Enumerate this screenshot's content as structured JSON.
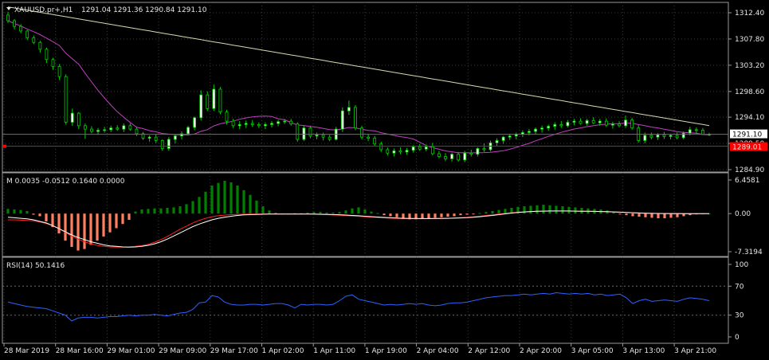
{
  "header": {
    "symbol_line": "XAUUSD.pr+,H1",
    "ohlc_line": "1291.04 1291.36 1290.84 1291.10"
  },
  "price_axis": {
    "ticks": [
      "1312.40",
      "1307.80",
      "1303.20",
      "1298.60",
      "1294.10",
      "1289.50",
      "1284.90"
    ],
    "current_price": "1291.10",
    "alert_price": "1289.01"
  },
  "momentum": {
    "label": "M 0.0035 -0.0512 0.1640 0.0000",
    "ticks": [
      "6.4581",
      "0.00",
      "-7.3194"
    ]
  },
  "rsi": {
    "label": "RSI(14) 50.1416",
    "ticks": [
      "100",
      "70",
      "30",
      "0"
    ]
  },
  "time_axis": {
    "labels": [
      "28 Mar 2019",
      "28 Mar 16:00",
      "29 Mar 01:00",
      "29 Mar 09:00",
      "29 Mar 17:00",
      "1 Apr 02:00",
      "1 Apr 11:00",
      "1 Apr 19:00",
      "2 Apr 04:00",
      "2 Apr 12:00",
      "2 Apr 20:00",
      "3 Apr 05:00",
      "3 Apr 13:00",
      "3 Apr 21:00"
    ]
  },
  "colors": {
    "background": "#000000",
    "grid": "#3a3a3a",
    "bull_candle": "#ffffff",
    "bear_candle": "#000000",
    "candle_outline": "#00d000",
    "ma_fast": "#c040c0",
    "ma_slow": "#d8d8b0",
    "alert_line": "#ff0000",
    "hist_positive": "#008000",
    "hist_negative": "#ff8060",
    "signal_line": "#ff2020",
    "main_line": "#ffffff",
    "rsi_line": "#3060ff"
  },
  "chart_data": [
    {
      "type": "candlestick",
      "title": "XAUUSD.pr+,H1",
      "ylim": [
        1284.9,
        1312.4
      ],
      "ohlc": [
        [
          1312.0,
          1312.6,
          1310.6,
          1311.0
        ],
        [
          1311.0,
          1311.3,
          1309.5,
          1310.0
        ],
        [
          1310.0,
          1310.4,
          1308.8,
          1309.2
        ],
        [
          1309.2,
          1309.4,
          1307.6,
          1308.0
        ],
        [
          1308.0,
          1308.4,
          1306.9,
          1307.2
        ],
        [
          1307.2,
          1307.5,
          1305.4,
          1306.0
        ],
        [
          1306.0,
          1306.3,
          1303.6,
          1304.2
        ],
        [
          1304.2,
          1304.5,
          1302.4,
          1303.0
        ],
        [
          1303.0,
          1303.4,
          1300.6,
          1301.2
        ],
        [
          1301.2,
          1301.6,
          1292.8,
          1293.2
        ],
        [
          1293.2,
          1295.6,
          1292.6,
          1294.8
        ],
        [
          1294.8,
          1295.0,
          1292.0,
          1292.6
        ],
        [
          1292.6,
          1293.0,
          1290.3,
          1292.0
        ],
        [
          1292.0,
          1292.5,
          1291.3,
          1291.6
        ],
        [
          1291.6,
          1292.2,
          1291.0,
          1291.8
        ],
        [
          1291.8,
          1292.4,
          1291.4,
          1291.9
        ],
        [
          1291.9,
          1292.6,
          1291.5,
          1292.2
        ],
        [
          1292.2,
          1292.7,
          1291.7,
          1292.0
        ],
        [
          1292.0,
          1293.0,
          1291.5,
          1292.6
        ],
        [
          1292.6,
          1293.0,
          1291.7,
          1292.0
        ],
        [
          1292.0,
          1292.4,
          1290.8,
          1291.2
        ],
        [
          1291.2,
          1291.5,
          1290.1,
          1290.4
        ],
        [
          1290.4,
          1290.9,
          1289.8,
          1290.6
        ],
        [
          1290.6,
          1291.2,
          1289.6,
          1290.0
        ],
        [
          1290.0,
          1290.2,
          1288.2,
          1288.6
        ],
        [
          1288.6,
          1290.6,
          1288.2,
          1290.2
        ],
        [
          1290.2,
          1291.0,
          1289.5,
          1290.8
        ],
        [
          1290.8,
          1291.6,
          1290.2,
          1291.2
        ],
        [
          1291.2,
          1292.6,
          1290.9,
          1292.3
        ],
        [
          1292.3,
          1294.2,
          1291.8,
          1294.0
        ],
        [
          1294.0,
          1298.8,
          1293.5,
          1298.0
        ],
        [
          1298.0,
          1298.6,
          1295.2,
          1295.6
        ],
        [
          1295.6,
          1299.8,
          1295.2,
          1299.0
        ],
        [
          1299.0,
          1299.4,
          1294.6,
          1295.0
        ],
        [
          1295.0,
          1295.4,
          1292.8,
          1293.4
        ],
        [
          1293.4,
          1293.8,
          1292.2,
          1292.6
        ],
        [
          1292.6,
          1293.4,
          1292.0,
          1292.8
        ],
        [
          1292.8,
          1293.5,
          1292.2,
          1293.0
        ],
        [
          1293.0,
          1293.6,
          1292.4,
          1292.8
        ],
        [
          1292.8,
          1293.2,
          1292.2,
          1292.6
        ],
        [
          1292.6,
          1293.2,
          1292.0,
          1292.8
        ],
        [
          1292.8,
          1293.4,
          1292.3,
          1293.0
        ],
        [
          1293.0,
          1293.6,
          1292.5,
          1293.3
        ],
        [
          1293.3,
          1293.8,
          1292.9,
          1293.4
        ],
        [
          1293.4,
          1293.8,
          1292.6,
          1292.9
        ],
        [
          1292.9,
          1293.2,
          1289.8,
          1290.2
        ],
        [
          1290.2,
          1292.6,
          1289.9,
          1292.2
        ],
        [
          1292.2,
          1292.6,
          1290.4,
          1290.8
        ],
        [
          1290.8,
          1291.4,
          1290.2,
          1291.0
        ],
        [
          1291.0,
          1291.4,
          1290.0,
          1290.6
        ],
        [
          1290.6,
          1291.0,
          1289.9,
          1290.2
        ],
        [
          1290.2,
          1292.4,
          1290.0,
          1292.0
        ],
        [
          1292.0,
          1295.8,
          1291.5,
          1295.2
        ],
        [
          1295.2,
          1297.0,
          1294.5,
          1295.8
        ],
        [
          1295.8,
          1296.2,
          1291.8,
          1292.2
        ],
        [
          1292.2,
          1292.6,
          1290.2,
          1290.6
        ],
        [
          1290.6,
          1291.2,
          1289.9,
          1290.4
        ],
        [
          1290.4,
          1290.8,
          1289.0,
          1289.4
        ],
        [
          1289.4,
          1289.8,
          1288.0,
          1288.4
        ],
        [
          1288.4,
          1288.8,
          1287.4,
          1287.8
        ],
        [
          1287.8,
          1288.6,
          1287.2,
          1288.2
        ],
        [
          1288.2,
          1288.8,
          1287.6,
          1288.0
        ],
        [
          1288.0,
          1288.7,
          1287.5,
          1288.3
        ],
        [
          1288.3,
          1289.2,
          1287.9,
          1288.9
        ],
        [
          1288.9,
          1289.4,
          1288.2,
          1288.5
        ],
        [
          1288.5,
          1289.3,
          1288.1,
          1288.9
        ],
        [
          1288.9,
          1289.6,
          1287.4,
          1287.7
        ],
        [
          1287.7,
          1288.2,
          1286.9,
          1287.2
        ],
        [
          1287.2,
          1287.8,
          1286.4,
          1286.8
        ],
        [
          1286.8,
          1287.9,
          1286.3,
          1287.6
        ],
        [
          1287.6,
          1288.0,
          1286.3,
          1286.6
        ],
        [
          1286.6,
          1288.2,
          1286.2,
          1287.8
        ],
        [
          1287.8,
          1288.4,
          1287.2,
          1287.6
        ],
        [
          1287.6,
          1288.8,
          1287.2,
          1288.6
        ],
        [
          1288.6,
          1289.5,
          1288.0,
          1288.4
        ],
        [
          1288.4,
          1290.0,
          1288.1,
          1289.6
        ],
        [
          1289.6,
          1290.4,
          1289.0,
          1290.0
        ],
        [
          1290.0,
          1290.8,
          1289.4,
          1290.6
        ],
        [
          1290.6,
          1291.2,
          1290.1,
          1290.8
        ],
        [
          1290.8,
          1291.4,
          1290.2,
          1291.1
        ],
        [
          1291.1,
          1291.8,
          1290.6,
          1291.4
        ],
        [
          1291.4,
          1292.0,
          1290.9,
          1291.6
        ],
        [
          1291.6,
          1292.3,
          1291.1,
          1292.0
        ],
        [
          1292.0,
          1292.6,
          1291.4,
          1292.2
        ],
        [
          1292.2,
          1292.8,
          1291.7,
          1292.5
        ],
        [
          1292.5,
          1293.2,
          1291.9,
          1292.8
        ],
        [
          1292.8,
          1293.4,
          1292.2,
          1292.6
        ],
        [
          1292.6,
          1293.6,
          1292.3,
          1293.2
        ],
        [
          1293.2,
          1293.8,
          1292.7,
          1293.4
        ],
        [
          1293.4,
          1293.9,
          1292.8,
          1293.0
        ],
        [
          1293.0,
          1293.8,
          1292.6,
          1293.5
        ],
        [
          1293.5,
          1294.1,
          1292.9,
          1293.1
        ],
        [
          1293.1,
          1293.8,
          1292.6,
          1293.4
        ],
        [
          1293.4,
          1293.9,
          1292.4,
          1292.7
        ],
        [
          1292.7,
          1293.3,
          1292.1,
          1292.9
        ],
        [
          1292.9,
          1293.4,
          1292.3,
          1292.6
        ],
        [
          1292.6,
          1294.4,
          1292.2,
          1293.6
        ],
        [
          1293.6,
          1294.0,
          1291.9,
          1292.2
        ],
        [
          1292.2,
          1292.7,
          1289.6,
          1290.0
        ],
        [
          1290.0,
          1291.4,
          1289.5,
          1290.9
        ],
        [
          1290.9,
          1291.4,
          1290.2,
          1290.6
        ],
        [
          1290.6,
          1291.3,
          1290.1,
          1291.0
        ],
        [
          1291.0,
          1291.5,
          1290.3,
          1290.7
        ],
        [
          1290.7,
          1291.2,
          1290.2,
          1290.9
        ],
        [
          1290.9,
          1291.4,
          1290.2,
          1290.5
        ],
        [
          1290.5,
          1291.6,
          1290.2,
          1291.3
        ],
        [
          1291.3,
          1292.4,
          1290.9,
          1291.9
        ],
        [
          1291.9,
          1292.3,
          1291.2,
          1291.8
        ],
        [
          1291.8,
          1292.2,
          1291.0,
          1291.04
        ],
        [
          1291.04,
          1291.36,
          1290.84,
          1291.1
        ]
      ]
    },
    {
      "type": "bar+line",
      "title": "M 0.0035 -0.0512 0.1640 0.0000",
      "ylim": [
        -7.3194,
        6.4581
      ],
      "histogram": [
        0.9,
        0.8,
        0.7,
        0.5,
        -0.2,
        -0.5,
        -1.5,
        -2.6,
        -3.8,
        -5.2,
        -6.4,
        -7.1,
        -6.8,
        -6.0,
        -5.2,
        -4.4,
        -3.6,
        -2.8,
        -2.0,
        -1.2,
        0.4,
        0.8,
        0.9,
        1.0,
        1.0,
        1.1,
        1.2,
        1.4,
        1.8,
        2.4,
        3.2,
        4.2,
        5.4,
        5.9,
        6.3,
        6.0,
        5.4,
        4.5,
        3.6,
        2.5,
        1.4,
        0.6,
        0.2,
        0.0,
        0.0,
        0.1,
        0.1,
        0.2,
        0.3,
        0.3,
        0.2,
        0.2,
        0.3,
        0.6,
        1.0,
        1.2,
        0.8,
        0.4,
        0.1,
        -0.3,
        -0.5,
        -0.7,
        -1.0,
        -1.1,
        -1.1,
        -1.0,
        -0.9,
        -0.8,
        -0.7,
        -0.6,
        -0.5,
        -0.3,
        -0.2,
        -0.1,
        0.1,
        0.3,
        0.5,
        0.7,
        0.9,
        1.1,
        1.3,
        1.4,
        1.5,
        1.6,
        1.7,
        1.6,
        1.5,
        1.4,
        1.3,
        1.2,
        1.1,
        1.0,
        0.9,
        0.8,
        0.6,
        0.3,
        -0.1,
        -0.3,
        -0.5,
        -0.6,
        -0.7,
        -0.8,
        -0.9,
        -0.9,
        -0.8,
        -0.7,
        -0.5,
        -0.3,
        -0.1,
        0.0,
        0.0
      ],
      "main_line": [
        -0.7,
        -0.8,
        -0.9,
        -1.0,
        -1.2,
        -1.5,
        -1.8,
        -2.3,
        -2.9,
        -3.5,
        -4.1,
        -4.6,
        -5.0,
        -5.4,
        -5.7,
        -6.0,
        -6.2,
        -6.3,
        -6.4,
        -6.45,
        -6.4,
        -6.3,
        -6.1,
        -5.8,
        -5.4,
        -4.9,
        -4.3,
        -3.7,
        -3.1,
        -2.5,
        -2.0,
        -1.6,
        -1.2,
        -0.9,
        -0.7,
        -0.5,
        -0.35,
        -0.25,
        -0.2,
        -0.15,
        -0.12,
        -0.1,
        -0.1,
        -0.1,
        -0.1,
        -0.1,
        -0.1,
        -0.1,
        -0.1,
        -0.12,
        -0.14,
        -0.18,
        -0.22,
        -0.28,
        -0.35,
        -0.42,
        -0.5,
        -0.58,
        -0.66,
        -0.74,
        -0.8,
        -0.86,
        -0.9,
        -0.92,
        -0.94,
        -0.95,
        -0.95,
        -0.94,
        -0.92,
        -0.9,
        -0.87,
        -0.83,
        -0.78,
        -0.7,
        -0.6,
        -0.48,
        -0.35,
        -0.2,
        -0.05,
        0.1,
        0.22,
        0.32,
        0.4,
        0.45,
        0.48,
        0.5,
        0.5,
        0.5,
        0.5,
        0.48,
        0.46,
        0.44,
        0.42,
        0.4,
        0.36,
        0.32,
        0.27,
        0.22,
        0.17,
        0.12,
        0.08,
        0.05,
        0.03,
        0.02,
        0.01,
        0.01,
        0.0,
        0.0,
        0.0,
        0.0,
        0.0
      ],
      "signal_line": [
        -1.2,
        -1.2,
        -1.25,
        -1.3,
        -1.4,
        -1.6,
        -1.9,
        -2.3,
        -2.9,
        -3.6,
        -4.3,
        -4.9,
        -5.4,
        -5.8,
        -6.1,
        -6.3,
        -6.4,
        -6.45,
        -6.45,
        -6.4,
        -6.3,
        -6.15,
        -5.9,
        -5.5,
        -5.0,
        -4.4,
        -3.7,
        -3.0,
        -2.4,
        -1.8,
        -1.3,
        -0.9,
        -0.6,
        -0.4,
        -0.3,
        -0.2,
        -0.15,
        -0.12,
        -0.1,
        -0.1,
        -0.1,
        -0.1,
        -0.1,
        -0.1,
        -0.1,
        -0.1,
        -0.1,
        -0.1,
        -0.12,
        -0.15,
        -0.2,
        -0.26,
        -0.32,
        -0.38,
        -0.45,
        -0.52,
        -0.6,
        -0.68,
        -0.75,
        -0.82,
        -0.88,
        -0.92,
        -0.95,
        -0.97,
        -0.98,
        -0.98,
        -0.97,
        -0.95,
        -0.93,
        -0.9,
        -0.86,
        -0.8,
        -0.72,
        -0.62,
        -0.5,
        -0.36,
        -0.22,
        -0.08,
        0.05,
        0.16,
        0.26,
        0.34,
        0.4,
        0.44,
        0.47,
        0.48,
        0.49,
        0.49,
        0.48,
        0.47,
        0.46,
        0.44,
        0.42,
        0.4,
        0.37,
        0.33,
        0.28,
        0.22,
        0.16,
        0.11,
        0.07,
        0.04,
        0.02,
        0.01,
        0.0,
        0.0,
        0.0,
        0.0,
        0.0,
        0.0,
        0.0
      ]
    },
    {
      "type": "line",
      "title": "RSI(14) 50.1416",
      "ylim": [
        0,
        100
      ],
      "levels": [
        70,
        30
      ],
      "values": [
        48,
        46,
        44,
        42,
        41,
        40,
        39,
        36,
        33,
        30,
        22,
        26,
        27,
        27,
        26,
        27,
        28,
        28,
        29,
        30,
        29,
        30,
        30,
        31,
        30,
        29,
        31,
        33,
        34,
        38,
        47,
        48,
        57,
        55,
        48,
        45,
        44,
        44,
        45,
        45,
        44,
        45,
        46,
        46,
        44,
        40,
        45,
        44,
        45,
        45,
        44,
        45,
        50,
        56,
        58,
        52,
        50,
        48,
        46,
        44,
        45,
        44,
        45,
        46,
        45,
        46,
        44,
        43,
        44,
        46,
        47,
        47,
        48,
        50,
        52,
        54,
        55,
        56,
        57,
        57,
        58,
        59,
        58,
        59,
        60,
        59,
        61,
        60,
        59,
        60,
        59,
        60,
        58,
        59,
        57,
        58,
        59,
        54,
        46,
        50,
        52,
        49,
        50,
        51,
        50,
        49,
        52,
        54,
        53,
        52,
        50
      ]
    }
  ]
}
